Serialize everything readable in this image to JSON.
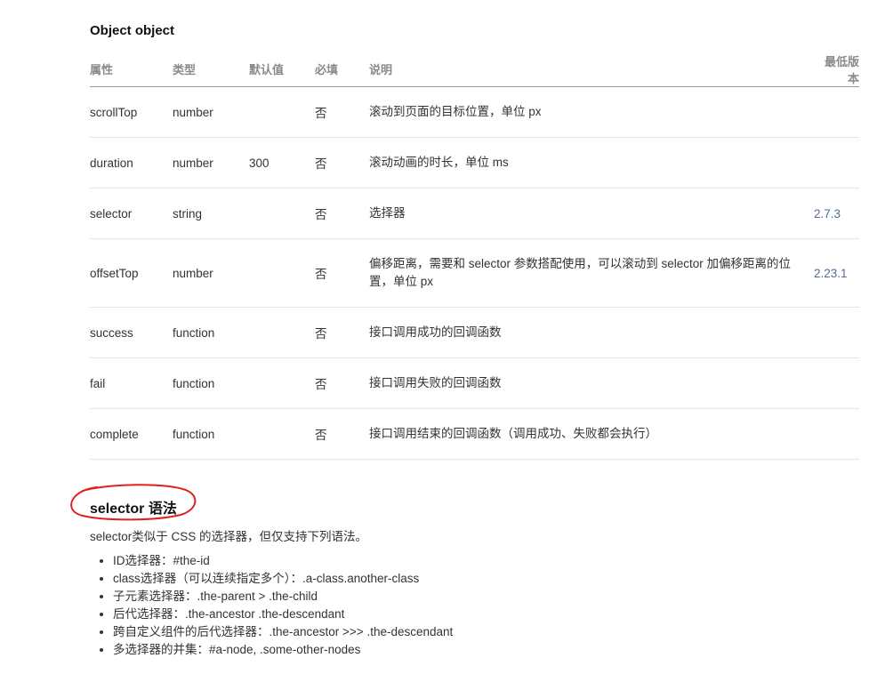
{
  "object_title": "Object object",
  "table": {
    "headers": [
      "属性",
      "类型",
      "默认值",
      "必填",
      "说明",
      "最低版本"
    ],
    "rows": [
      {
        "attr": "scrollTop",
        "type": "number",
        "default": "",
        "required": "否",
        "desc": "滚动到页面的目标位置，单位 px",
        "version": ""
      },
      {
        "attr": "duration",
        "type": "number",
        "default": "300",
        "required": "否",
        "desc": "滚动动画的时长，单位 ms",
        "version": ""
      },
      {
        "attr": "selector",
        "type": "string",
        "default": "",
        "required": "否",
        "desc": "选择器",
        "version": "2.7.3"
      },
      {
        "attr": "offsetTop",
        "type": "number",
        "default": "",
        "required": "否",
        "desc": "偏移距离，需要和 selector 参数搭配使用，可以滚动到 selector 加偏移距离的位置，单位 px",
        "version": "2.23.1"
      },
      {
        "attr": "success",
        "type": "function",
        "default": "",
        "required": "否",
        "desc": "接口调用成功的回调函数",
        "version": ""
      },
      {
        "attr": "fail",
        "type": "function",
        "default": "",
        "required": "否",
        "desc": "接口调用失败的回调函数",
        "version": ""
      },
      {
        "attr": "complete",
        "type": "function",
        "default": "",
        "required": "否",
        "desc": "接口调用结束的回调函数（调用成功、失败都会执行）",
        "version": ""
      }
    ]
  },
  "selector_section": {
    "title": "selector 语法",
    "intro": "selector类似于 CSS 的选择器，但仅支持下列语法。",
    "items": [
      "ID选择器：#the-id",
      "class选择器（可以连续指定多个）：.a-class.another-class",
      "子元素选择器：.the-parent > .the-child",
      "后代选择器：.the-ancestor .the-descendant",
      "跨自定义组件的后代选择器：.the-ancestor >>> .the-descendant",
      "多选择器的并集：#a-node, .some-other-nodes"
    ]
  },
  "colors": {
    "link": "#576b95",
    "annotation_circle": "#e02020"
  }
}
